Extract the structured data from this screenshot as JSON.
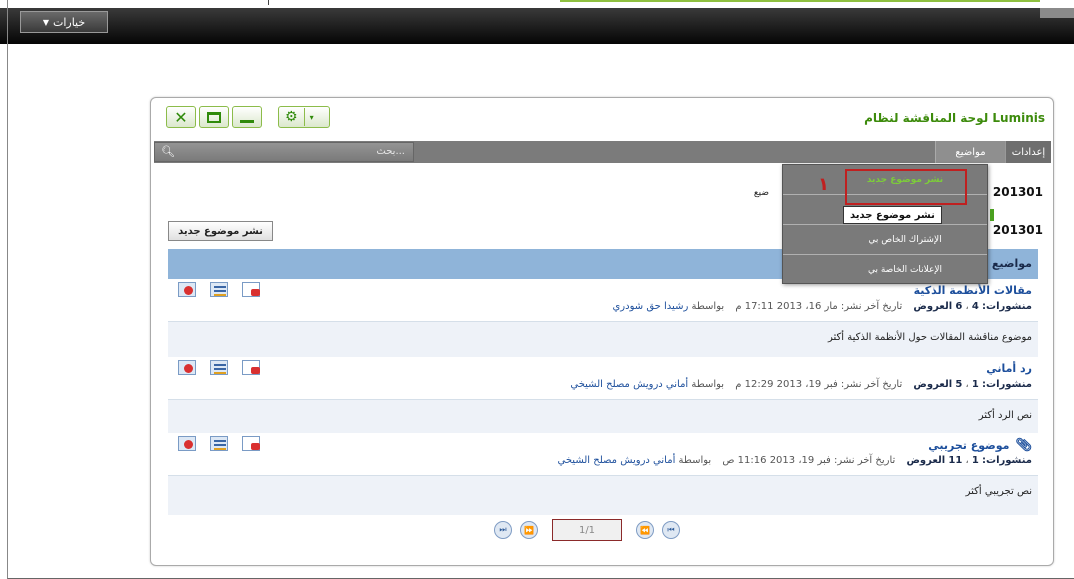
{
  "topbar": {
    "options_label": "خيارات"
  },
  "panel": {
    "title": "لوحة المناقشة لنظام Luminis",
    "tabs": {
      "settings": "إعدادات",
      "topics": "مواضيع"
    },
    "search_placeholder": "بحث...",
    "row_dates": [
      "201301",
      "201301"
    ],
    "row1_snippet": "ضيع",
    "new_topic_button": "نشر موضوع جديد",
    "topics_header": "مواضيع"
  },
  "dropdown": {
    "items": [
      "نشر موضوع جديد",
      "",
      "الإشتراك الخاص بي",
      "الإعلانات الخاصة بي"
    ],
    "callout_number": "١",
    "tooltip": "نشر موضوع جديد"
  },
  "topics": [
    {
      "title": "مقالات الأنظمة الذكية",
      "posts_label": "منشورات:",
      "posts": "4",
      "views": "6",
      "views_label": "العروض",
      "last_post": "تاريخ آخر نشر: مار 16، 2013 17:11 م",
      "by_label": "بواسطة",
      "author": "رشيدا حق شودري",
      "desc": "موضوع مناقشة المقالات حول الأنظمة الذكية أكثر"
    },
    {
      "title": "رد أماني",
      "posts_label": "منشورات:",
      "posts": "1",
      "views": "5",
      "views_label": "العروض",
      "last_post": "تاريخ آخر نشر: فبر 19، 2013 12:29 م",
      "by_label": "بواسطة",
      "author": "أماني درويش مصلح الشيخي",
      "desc": "نص الرد أكثر"
    },
    {
      "title": "موضوع تجريبي",
      "posts_label": "منشورات:",
      "posts": "1",
      "views": "11",
      "views_label": "العروض",
      "last_post": "تاريخ آخر نشر: فبر 19، 2013 11:16 ص",
      "by_label": "بواسطة",
      "author": "أماني درويش مصلح الشيخي",
      "desc": "نص تجريبي أكثر"
    }
  ],
  "pager": {
    "page": "1/1"
  },
  "colors": {
    "accent_green": "#3d8b0c",
    "link_blue": "#1d4f9c",
    "header_blue": "#8fb4d9",
    "callout_red": "#c02020"
  }
}
